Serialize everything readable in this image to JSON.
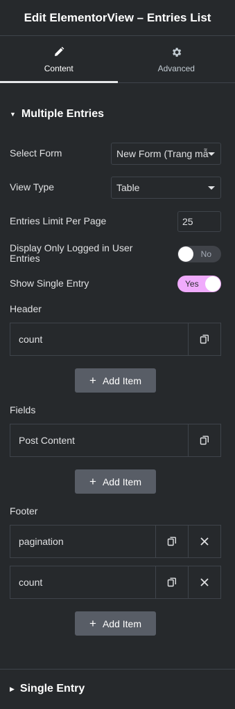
{
  "header": {
    "title": "Edit ElementorView – Entries List"
  },
  "tabs": [
    {
      "label": "Content",
      "icon": "pencil-icon",
      "active": true
    },
    {
      "label": "Advanced",
      "icon": "gear-icon",
      "active": false
    }
  ],
  "section_multiple": {
    "title": "Multiple Entries",
    "select_form": {
      "label": "Select Form",
      "value": "New Form (Trang mẫ"
    },
    "view_type": {
      "label": "View Type",
      "value": "Table"
    },
    "entries_limit": {
      "label": "Entries Limit Per Page",
      "value": "25"
    },
    "logged_in_only": {
      "label": "Display Only Logged in User Entries",
      "state": "No"
    },
    "show_single": {
      "label": "Show Single Entry",
      "state": "Yes"
    },
    "header_group": {
      "label": "Header",
      "items": [
        "count"
      ]
    },
    "fields_group": {
      "label": "Fields",
      "items": [
        "Post Content"
      ]
    },
    "footer_group": {
      "label": "Footer",
      "items": [
        "pagination",
        "count"
      ]
    },
    "add_item_label": "Add Item"
  },
  "section_single": {
    "title": "Single Entry"
  },
  "colors": {
    "background": "#26292c",
    "border": "#3f444b",
    "toggle_on": "#f0abfc",
    "button": "#585d66"
  }
}
